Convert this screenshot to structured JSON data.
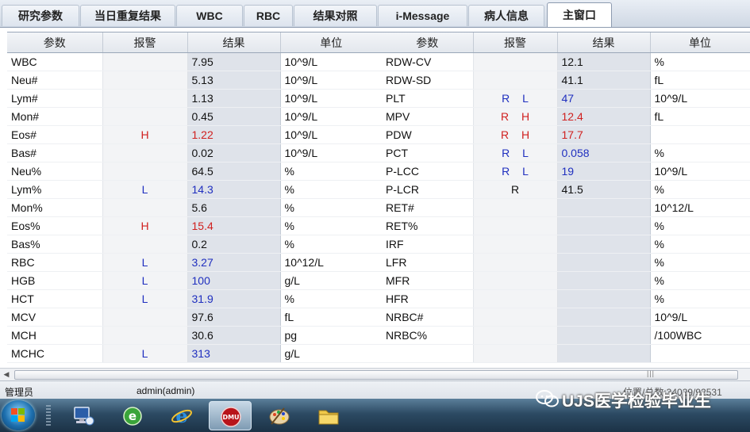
{
  "tabs": [
    {
      "label": "研究参数",
      "active": false
    },
    {
      "label": "当日重复结果",
      "active": false
    },
    {
      "label": "WBC",
      "active": false
    },
    {
      "label": "RBC",
      "active": false
    },
    {
      "label": "结果对照",
      "active": false
    },
    {
      "label": "i-Message",
      "active": false
    },
    {
      "label": "病人信息",
      "active": false
    },
    {
      "label": "主窗口",
      "active": true
    }
  ],
  "columns": {
    "param": "参数",
    "alarm": "报警",
    "result": "结果",
    "unit": "单位"
  },
  "left_rows": [
    {
      "name": "WBC",
      "alarm": "",
      "result": "7.95",
      "unit": "10^9/L",
      "flag": ""
    },
    {
      "name": "Neu#",
      "alarm": "",
      "result": "5.13",
      "unit": "10^9/L",
      "flag": ""
    },
    {
      "name": "Lym#",
      "alarm": "",
      "result": "1.13",
      "unit": "10^9/L",
      "flag": ""
    },
    {
      "name": "Mon#",
      "alarm": "",
      "result": "0.45",
      "unit": "10^9/L",
      "flag": ""
    },
    {
      "name": "Eos#",
      "alarm": "H",
      "result": "1.22",
      "unit": "10^9/L",
      "flag": "H"
    },
    {
      "name": "Bas#",
      "alarm": "",
      "result": "0.02",
      "unit": "10^9/L",
      "flag": ""
    },
    {
      "name": "Neu%",
      "alarm": "",
      "result": "64.5",
      "unit": "%",
      "flag": ""
    },
    {
      "name": "Lym%",
      "alarm": "L",
      "result": "14.3",
      "unit": "%",
      "flag": "L"
    },
    {
      "name": "Mon%",
      "alarm": "",
      "result": "5.6",
      "unit": "%",
      "flag": ""
    },
    {
      "name": "Eos%",
      "alarm": "H",
      "result": "15.4",
      "unit": "%",
      "flag": "H"
    },
    {
      "name": "Bas%",
      "alarm": "",
      "result": "0.2",
      "unit": "%",
      "flag": ""
    },
    {
      "name": "RBC",
      "alarm": "L",
      "result": "3.27",
      "unit": "10^12/L",
      "flag": "L"
    },
    {
      "name": "HGB",
      "alarm": "L",
      "result": "100",
      "unit": "g/L",
      "flag": "L"
    },
    {
      "name": "HCT",
      "alarm": "L",
      "result": "31.9",
      "unit": "%",
      "flag": "L"
    },
    {
      "name": "MCV",
      "alarm": "",
      "result": "97.6",
      "unit": "fL",
      "flag": ""
    },
    {
      "name": "MCH",
      "alarm": "",
      "result": "30.6",
      "unit": "pg",
      "flag": ""
    },
    {
      "name": "MCHC",
      "alarm": "L",
      "result": "313",
      "unit": "g/L",
      "flag": "L"
    }
  ],
  "right_rows": [
    {
      "name": "RDW-CV",
      "alarm": "",
      "result": "12.1",
      "unit": "%",
      "flag": ""
    },
    {
      "name": "RDW-SD",
      "alarm": "",
      "result": "41.1",
      "unit": "fL",
      "flag": ""
    },
    {
      "name": "PLT",
      "alarm": "R L",
      "result": "47",
      "unit": "10^9/L",
      "flag": "L"
    },
    {
      "name": "MPV",
      "alarm": "R H",
      "result": "12.4",
      "unit": "fL",
      "flag": "H"
    },
    {
      "name": "PDW",
      "alarm": "R H",
      "result": "17.7",
      "unit": "",
      "flag": "H"
    },
    {
      "name": "PCT",
      "alarm": "R L",
      "result": "0.058",
      "unit": "%",
      "flag": "L"
    },
    {
      "name": "P-LCC",
      "alarm": "R L",
      "result": "19",
      "unit": "10^9/L",
      "flag": "L"
    },
    {
      "name": "P-LCR",
      "alarm": "R",
      "result": "41.5",
      "unit": "%",
      "flag": ""
    },
    {
      "name": "RET#",
      "alarm": "",
      "result": "",
      "unit": "10^12/L",
      "flag": ""
    },
    {
      "name": "RET%",
      "alarm": "",
      "result": "",
      "unit": "%",
      "flag": ""
    },
    {
      "name": "IRF",
      "alarm": "",
      "result": "",
      "unit": "%",
      "flag": ""
    },
    {
      "name": "LFR",
      "alarm": "",
      "result": "",
      "unit": "%",
      "flag": ""
    },
    {
      "name": "MFR",
      "alarm": "",
      "result": "",
      "unit": "%",
      "flag": ""
    },
    {
      "name": "HFR",
      "alarm": "",
      "result": "",
      "unit": "%",
      "flag": ""
    },
    {
      "name": "NRBC#",
      "alarm": "",
      "result": "",
      "unit": "10^9/L",
      "flag": ""
    },
    {
      "name": "NRBC%",
      "alarm": "",
      "result": "",
      "unit": "/100WBC",
      "flag": ""
    },
    {
      "name": "",
      "alarm": "",
      "result": "",
      "unit": "",
      "flag": ""
    }
  ],
  "status": {
    "role": "管理员",
    "user": "admin(admin)",
    "position": "位置/总数:34029/92531"
  },
  "watermark": "UJS医学检验毕业生",
  "taskbar": {
    "apps": [
      {
        "icon": "network-computer-icon",
        "active": false
      },
      {
        "icon": "browser-e-green-icon",
        "active": false
      },
      {
        "icon": "internet-explorer-icon",
        "active": false
      },
      {
        "icon": "analyzer-dm-icon",
        "label": "DMU",
        "active": true
      },
      {
        "icon": "paint-palette-icon",
        "active": false
      },
      {
        "icon": "folder-icon",
        "active": false
      }
    ]
  },
  "colors": {
    "high": "#d0201f",
    "low": "#1f2fbf",
    "result_bg": "#dfe3ea"
  }
}
